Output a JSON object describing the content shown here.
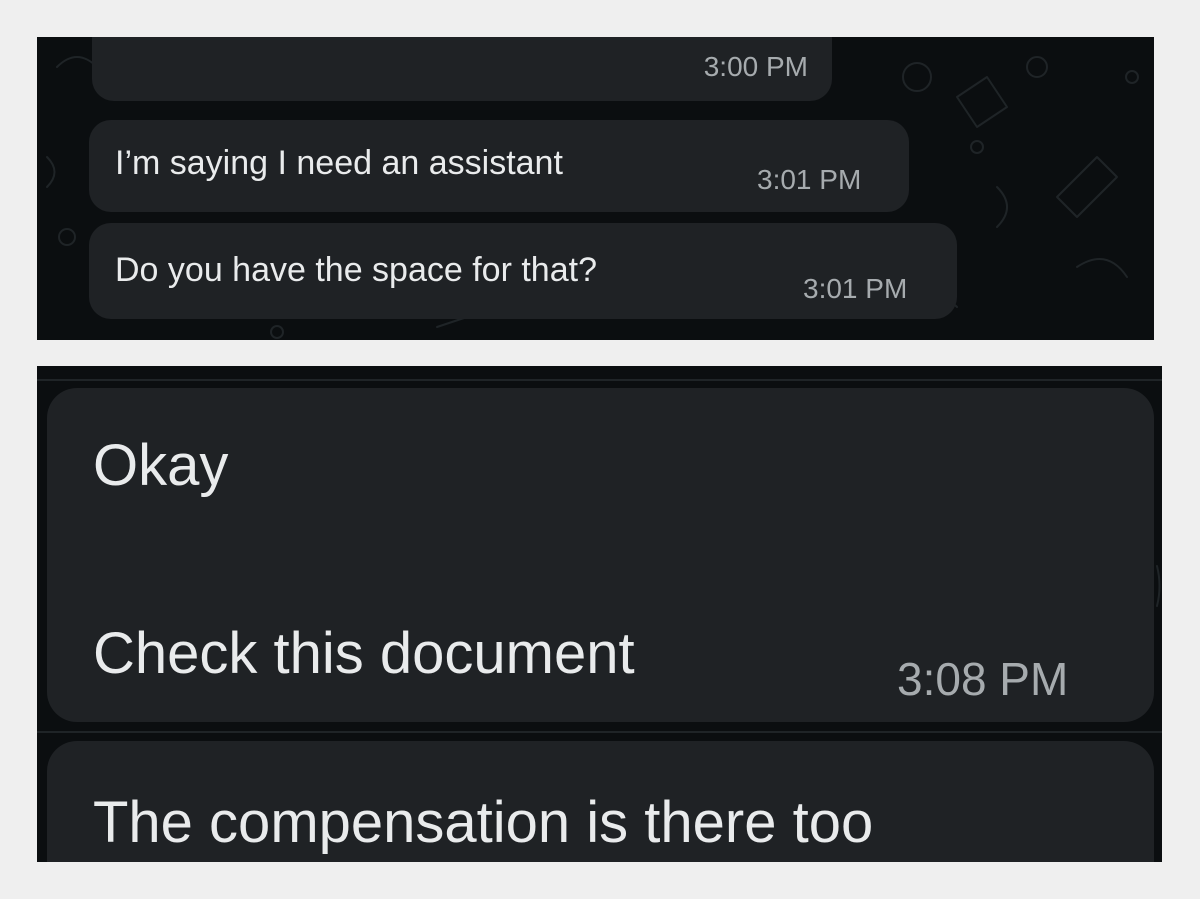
{
  "top_screenshot": {
    "messages": [
      {
        "text": "",
        "time": "3:00 PM"
      },
      {
        "text": "I’m saying I need an assistant",
        "time": "3:01 PM"
      },
      {
        "text": "Do you have the space for that?",
        "time": "3:01 PM"
      }
    ]
  },
  "bottom_screenshot": {
    "messages": [
      {
        "line1": "Okay",
        "line2": "Check this document",
        "time": "3:08 PM"
      },
      {
        "text": "The compensation is there too"
      }
    ]
  },
  "colors": {
    "chat_background": "#0b0e10",
    "bubble": "#1f2225",
    "message_text": "#e9ebec",
    "timestamp_text": "#a6abae",
    "frame": "#efefef"
  }
}
